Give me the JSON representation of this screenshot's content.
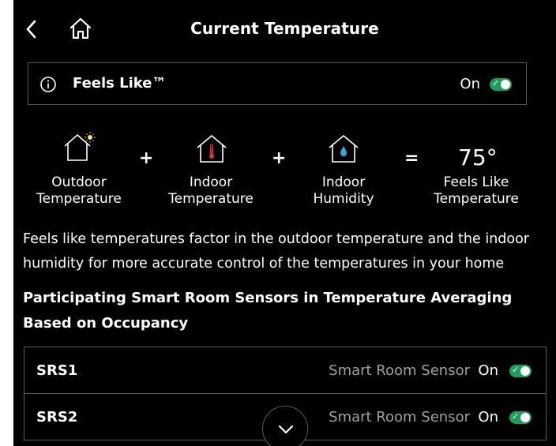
{
  "header": {
    "title": "Current Temperature"
  },
  "feels_like": {
    "label": "Feels Like™",
    "state": "On",
    "enabled": true
  },
  "equation": {
    "outdoor": {
      "line1": "Outdoor",
      "line2": "Temperature"
    },
    "indoor_temp": {
      "line1": "Indoor",
      "line2": "Temperature"
    },
    "indoor_humidity": {
      "line1": "Indoor",
      "line2": "Humidity"
    },
    "result": {
      "value": "75°",
      "line1": "Feels Like",
      "line2": "Temperature"
    },
    "plus": "+",
    "equals": "="
  },
  "description": "Feels like temperatures factor in the outdoor temperature and the indoor humidity for more accurate control of the temperatures in your home",
  "section_title": "Participating Smart Room Sensors in Temperature Averaging Based on Occupancy",
  "sensors": [
    {
      "name": "SRS1",
      "type": "Smart Room Sensor",
      "state": "On",
      "enabled": true
    },
    {
      "name": "SRS2",
      "type": "Smart Room Sensor",
      "state": "On",
      "enabled": true
    }
  ],
  "colors": {
    "background": "#000000",
    "toggle_on": "#1aa05a",
    "muted_text": "#a0a0a0",
    "border": "#5a5a5a",
    "thermometer": "#e0303a",
    "humidity_drop": "#3aa0e0",
    "sun": "#ffe066"
  },
  "icons": [
    "back-chevron-icon",
    "home-icon",
    "info-icon",
    "house-sun-icon",
    "house-thermometer-icon",
    "house-drop-icon",
    "chevron-down-icon"
  ]
}
